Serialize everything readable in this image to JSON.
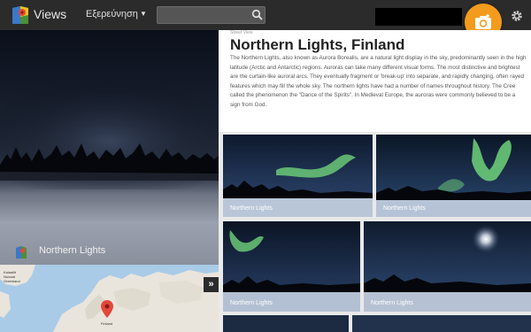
{
  "header": {
    "app_title": "Views",
    "explore_label": "Εξερεύνηση",
    "search_value": ""
  },
  "panorama": {
    "title": "Northern Lights"
  },
  "map": {
    "labels": [
      "Kalaallit",
      "Nunaat",
      "Greenland",
      "Finland"
    ]
  },
  "detail": {
    "street_label": "Street View",
    "title": "Northern Lights, Finland",
    "description": "The Northern Lights, also known as Aurora Borealis, are a natural light display in the sky, predominantly seen in the high latitude (Arctic and Antarctic) regions. Auroras can take many different visual forms. The most distinctive and brightest are the curtain-like auroral arcs. They eventually fragment or 'break-up' into separate, and rapidly changing, often rayed features which may fill the whole sky. The northern lights have had a number of names throughout history. The Cree called the phenomenon the \"Dance of the Spirits\". In Medieval Europe, the auroras were commonly believed to be a sign from God."
  },
  "gallery": [
    {
      "label": "Northern Lights"
    },
    {
      "label": "Northern Lights"
    },
    {
      "label": "Northern Lights"
    },
    {
      "label": "Northern Lights"
    }
  ],
  "colors": {
    "topbar": "#2b2b2b",
    "accent": "#f39b1c",
    "aurora": "#6fd27a"
  },
  "icons": {
    "logo": "maps-pin-icon",
    "search": "search-icon",
    "camera": "add-photo-icon",
    "settings": "gear-icon",
    "expand": "chevron-right-double-icon"
  }
}
